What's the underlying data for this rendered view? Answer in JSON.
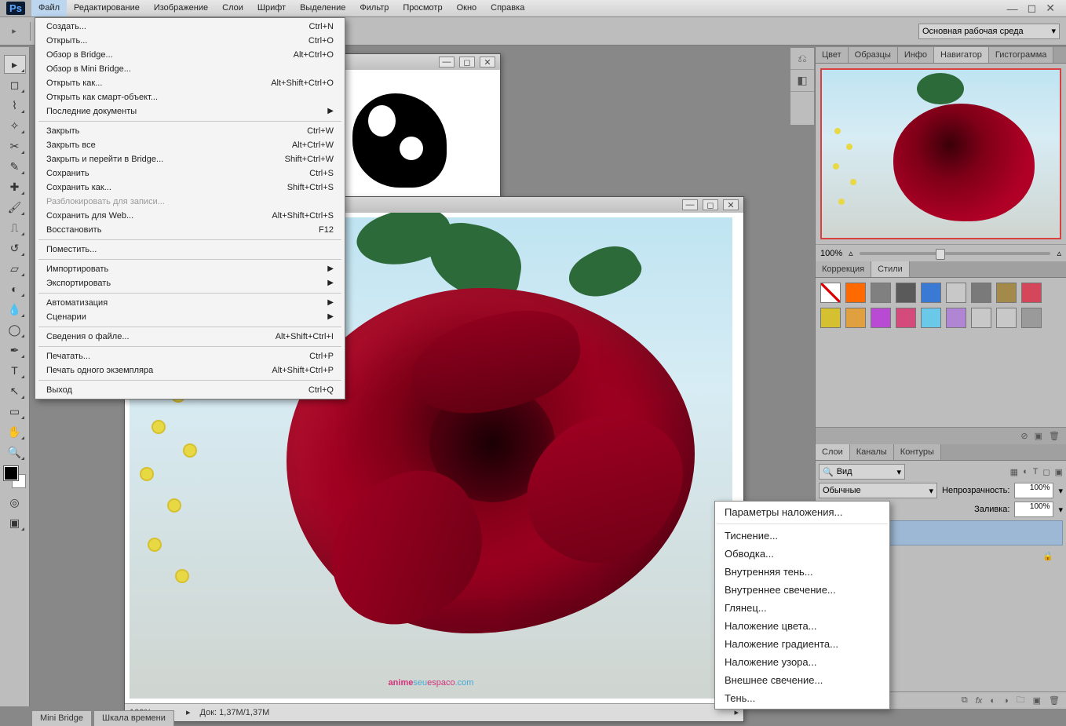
{
  "menubar": {
    "items": [
      "Файл",
      "Редактирование",
      "Изображение",
      "Слои",
      "Шрифт",
      "Выделение",
      "Фильтр",
      "Просмотр",
      "Окно",
      "Справка"
    ]
  },
  "workspace_label": "Основная рабочая среда",
  "file_menu": [
    {
      "label": "Создать...",
      "shortcut": "Ctrl+N"
    },
    {
      "label": "Открыть...",
      "shortcut": "Ctrl+O"
    },
    {
      "label": "Обзор в Bridge...",
      "shortcut": "Alt+Ctrl+O"
    },
    {
      "label": "Обзор в Mini Bridge...",
      "shortcut": ""
    },
    {
      "label": "Открыть как...",
      "shortcut": "Alt+Shift+Ctrl+O"
    },
    {
      "label": "Открыть как смарт-объект...",
      "shortcut": ""
    },
    {
      "label": "Последние документы",
      "shortcut": "",
      "submenu": true
    },
    {
      "sep": true
    },
    {
      "label": "Закрыть",
      "shortcut": "Ctrl+W"
    },
    {
      "label": "Закрыть все",
      "shortcut": "Alt+Ctrl+W"
    },
    {
      "label": "Закрыть и перейти в Bridge...",
      "shortcut": "Shift+Ctrl+W"
    },
    {
      "label": "Сохранить",
      "shortcut": "Ctrl+S"
    },
    {
      "label": "Сохранить как...",
      "shortcut": "Shift+Ctrl+S"
    },
    {
      "label": "Разблокировать для записи...",
      "shortcut": "",
      "disabled": true
    },
    {
      "label": "Сохранить для Web...",
      "shortcut": "Alt+Shift+Ctrl+S"
    },
    {
      "label": "Восстановить",
      "shortcut": "F12"
    },
    {
      "sep": true
    },
    {
      "label": "Поместить...",
      "shortcut": ""
    },
    {
      "sep": true
    },
    {
      "label": "Импортировать",
      "shortcut": "",
      "submenu": true
    },
    {
      "label": "Экспортировать",
      "shortcut": "",
      "submenu": true
    },
    {
      "sep": true
    },
    {
      "label": "Автоматизация",
      "shortcut": "",
      "submenu": true
    },
    {
      "label": "Сценарии",
      "shortcut": "",
      "submenu": true
    },
    {
      "sep": true
    },
    {
      "label": "Сведения о файле...",
      "shortcut": "Alt+Shift+Ctrl+I"
    },
    {
      "sep": true
    },
    {
      "label": "Печатать...",
      "shortcut": "Ctrl+P"
    },
    {
      "label": "Печать одного экземпляра",
      "shortcut": "Alt+Shift+Ctrl+P"
    },
    {
      "sep": true
    },
    {
      "label": "Выход",
      "shortcut": "Ctrl+Q"
    }
  ],
  "fx_menu": [
    {
      "label": "Параметры наложения..."
    },
    {
      "sep": true
    },
    {
      "label": "Тиснение..."
    },
    {
      "label": "Обводка..."
    },
    {
      "label": "Внутренняя тень..."
    },
    {
      "label": "Внутреннее свечение..."
    },
    {
      "label": "Глянец..."
    },
    {
      "label": "Наложение цвета..."
    },
    {
      "label": "Наложение градиента..."
    },
    {
      "label": "Наложение узора..."
    },
    {
      "label": "Внешнее свечение..."
    },
    {
      "label": "Тень..."
    }
  ],
  "right_panels": {
    "top_tabs": [
      "Цвет",
      "Образцы",
      "Инфо",
      "Навигатор",
      "Гистограмма"
    ],
    "nav_zoom": "100%",
    "mid_tabs": [
      "Коррекция",
      "Стили"
    ],
    "bottom_tabs": [
      "Слои",
      "Каналы",
      "Контуры"
    ],
    "layers": {
      "filter_label": "Вид",
      "blend_mode": "Обычные",
      "opacity_label": "Непрозрачность:",
      "opacity_value": "100%",
      "fill_label": "Заливка:",
      "fill_value": "100%"
    }
  },
  "doc2": {
    "zoom": "100%",
    "docsize": "Док: 1,37M/1,37M",
    "watermark": {
      "p1": "anime",
      "p2": "seu",
      "p3": "espaco",
      "p4": ".com"
    }
  },
  "bottom_tabs": [
    "Mini Bridge",
    "Шкала времени"
  ],
  "style_colors": [
    "#ffffff",
    "#ff6a00",
    "#808080",
    "#5a5a5a",
    "#3a7ad4",
    "#c8c8c8",
    "#7a7a7a",
    "#a38a4a",
    "#d4475a",
    "#d4c030",
    "#e0a040",
    "#b84ad4",
    "#d44a7a",
    "#6ac8e8",
    "#b085d4",
    "#c8c8c8",
    "#c8c8c8",
    "#9a9a9a"
  ]
}
